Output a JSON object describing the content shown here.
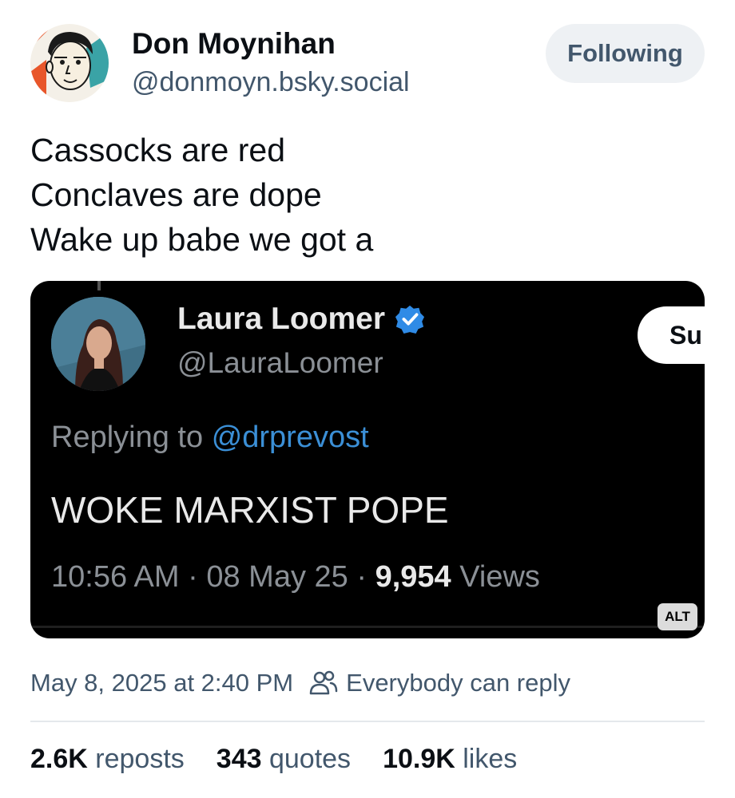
{
  "post": {
    "author_name": "Don Moynihan",
    "author_handle": "@donmoyn.bsky.social",
    "follow_label": "Following",
    "text_lines": [
      "Cassocks are red",
      "Conclaves are dope",
      "Wake up babe we got a"
    ],
    "timestamp": "May 8, 2025 at 2:40 PM",
    "reply_setting": "Everybody can reply"
  },
  "embedded": {
    "name": "Laura Loomer",
    "handle": "@LauraLoomer",
    "subscribe_partial": "Su",
    "replying_prefix": "Replying to",
    "replying_handle": "@drprevost",
    "text": "WOKE MARXIST POPE",
    "time": "10:56 AM",
    "date": "08 May 25",
    "views_count": "9,954",
    "views_label": "Views",
    "separator": "·",
    "alt_label": "ALT"
  },
  "stats": {
    "reposts_count": "2.6K",
    "reposts_label": "reposts",
    "quotes_count": "343",
    "quotes_label": "quotes",
    "likes_count": "10.9K",
    "likes_label": "likes"
  },
  "icons": {
    "verified": "verified-badge-icon",
    "reply_setting": "people-icon"
  },
  "colors": {
    "accent": "#3b8fd6",
    "muted": "#42576c",
    "media_bg": "#000000"
  }
}
